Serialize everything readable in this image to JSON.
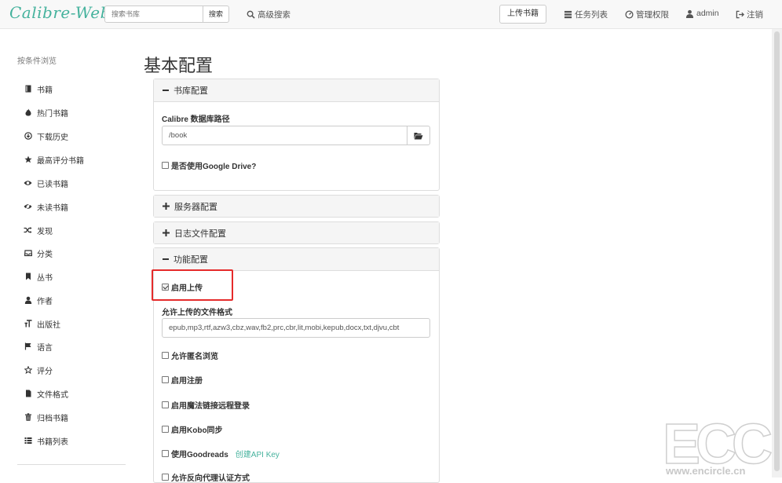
{
  "brand": {
    "logo": "Calibre-Web",
    "accent": "#45b29d"
  },
  "search": {
    "placeholder": "搜索书库",
    "button": "搜索"
  },
  "nav": {
    "advanced_search": "高级搜索",
    "upload": "上传书籍",
    "tasks": "任务列表",
    "admin_panel": "管理权限",
    "user": "admin",
    "logout": "注销"
  },
  "sidebar": {
    "title": "按条件浏览",
    "items": [
      {
        "label": "书籍",
        "icon": "book-icon"
      },
      {
        "label": "热门书籍",
        "icon": "fire-icon"
      },
      {
        "label": "下载历史",
        "icon": "download-icon"
      },
      {
        "label": "最高评分书籍",
        "icon": "star-icon"
      },
      {
        "label": "已读书籍",
        "icon": "eye-icon"
      },
      {
        "label": "未读书籍",
        "icon": "eye-slash-icon"
      },
      {
        "label": "发现",
        "icon": "random-icon"
      },
      {
        "label": "分类",
        "icon": "inbox-icon"
      },
      {
        "label": "丛书",
        "icon": "bookmark-icon"
      },
      {
        "label": "作者",
        "icon": "user-icon"
      },
      {
        "label": "出版社",
        "icon": "text-size-icon"
      },
      {
        "label": "语言",
        "icon": "flag-icon"
      },
      {
        "label": "评分",
        "icon": "star-empty-icon"
      },
      {
        "label": "文件格式",
        "icon": "file-icon"
      },
      {
        "label": "归档书籍",
        "icon": "trash-icon"
      },
      {
        "label": "书籍列表",
        "icon": "list-icon"
      }
    ]
  },
  "main": {
    "title": "基本配置",
    "library_panel": {
      "heading": "书库配置",
      "db_path_label": "Calibre 数据库路径",
      "db_path_value": "/book",
      "gdrive_label": "是否使用Google Drive?"
    },
    "server_panel": {
      "heading": "服务器配置"
    },
    "log_panel": {
      "heading": "日志文件配置"
    },
    "feature_panel": {
      "heading": "功能配置",
      "enable_upload": "启用上传",
      "allowed_formats_label": "允许上传的文件格式",
      "allowed_formats_value": "epub,mp3,rtf,azw3,cbz,wav,fb2,prc,cbr,lit,mobi,kepub,docx,txt,djvu,cbt",
      "anon_browse": "允许匿名浏览",
      "enable_register": "启用注册",
      "magic_link": "启用魔法链接远程登录",
      "kobo_sync": "启用Kobo同步",
      "goodreads": "使用Goodreads",
      "create_api_key": "创建API Key",
      "reverse_proxy": "允许反向代理认证方式"
    }
  },
  "watermark": {
    "letters": "ECC",
    "site": "www.encircle.cn"
  }
}
